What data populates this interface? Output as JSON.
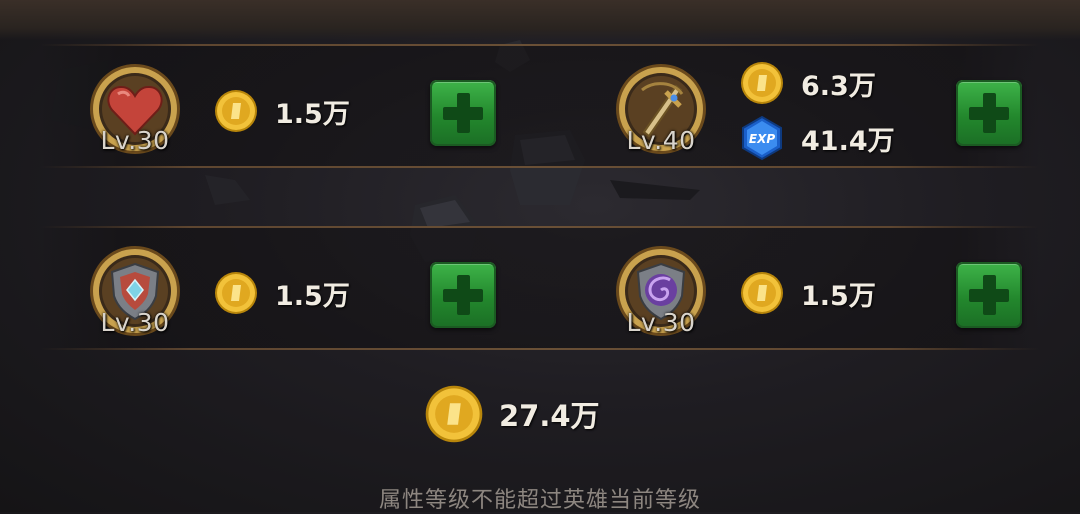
{
  "upgrades": [
    {
      "id": "heart",
      "level": "Lv.30",
      "coin_cost": "1.5万"
    },
    {
      "id": "sword",
      "level": "Lv.40",
      "coin_cost": "6.3万",
      "exp_cost": "41.4万"
    },
    {
      "id": "shield-gem",
      "level": "Lv.30",
      "coin_cost": "1.5万"
    },
    {
      "id": "shield-swirl",
      "level": "Lv.30",
      "coin_cost": "1.5万"
    }
  ],
  "total_cost": "27.4万",
  "notice": "属性等级不能超过英雄当前等级",
  "exp_icon_label": "EXP",
  "icons": {
    "coin": "gold-coin-icon",
    "exp": "exp-crystal-icon",
    "plus": "plus-icon"
  },
  "colors": {
    "button_green": "#2f9e3a",
    "coin_gold": "#f2c23a",
    "text": "#f1ece2",
    "level_text": "#d9d4cc"
  }
}
